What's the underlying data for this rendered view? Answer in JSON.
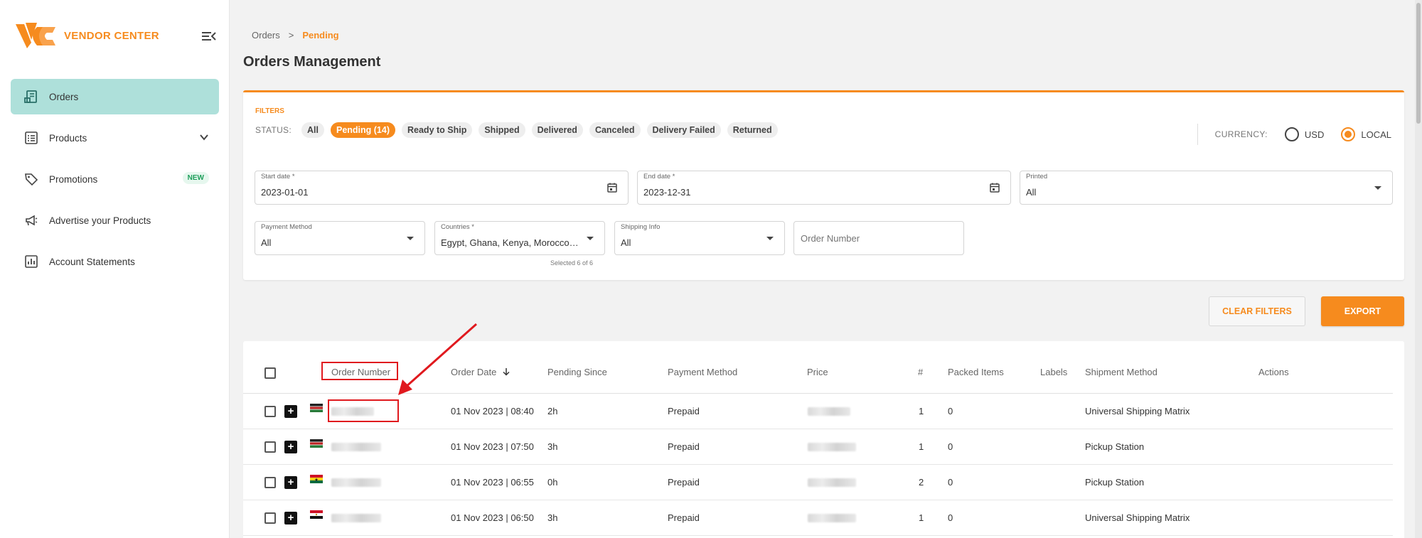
{
  "brand": {
    "name": "VENDOR CENTER",
    "accent": "#f68b1e",
    "active_nav_bg": "#aee0da"
  },
  "sidebar": {
    "collapse_icon": "menu-collapse-icon",
    "items": [
      {
        "label": "Orders",
        "icon": "receipt-icon",
        "active": true
      },
      {
        "label": "Products",
        "icon": "list-icon",
        "has_chevron": true
      },
      {
        "label": "Promotions",
        "icon": "tag-icon",
        "badge": "NEW"
      },
      {
        "label": "Advertise your Products",
        "icon": "megaphone-icon"
      },
      {
        "label": "Account Statements",
        "icon": "chart-icon"
      }
    ]
  },
  "breadcrumb": {
    "parent": "Orders",
    "separator": ">",
    "current": "Pending"
  },
  "page_title": "Orders Management",
  "filters": {
    "label": "FILTERS",
    "status_label": "STATUS:",
    "statuses": [
      "All",
      "Pending (14)",
      "Ready to Ship",
      "Shipped",
      "Delivered",
      "Canceled",
      "Delivery Failed",
      "Returned"
    ],
    "active_status": "Pending (14)",
    "currency": {
      "label": "CURRENCY:",
      "options": [
        "USD",
        "LOCAL"
      ],
      "selected": "LOCAL"
    },
    "start_date": {
      "label": "Start date *",
      "value": "2023-01-01"
    },
    "end_date": {
      "label": "End date *",
      "value": "2023-12-31"
    },
    "printed": {
      "label": "Printed",
      "value": "All"
    },
    "payment_method": {
      "label": "Payment Method",
      "value": "All"
    },
    "countries": {
      "label": "Countries *",
      "value": "Egypt, Ghana, Kenya, Morocco, ...",
      "helper": "Selected 6 of 6"
    },
    "shipping_info": {
      "label": "Shipping Info",
      "value": "All"
    },
    "order_number": {
      "placeholder": "Order Number"
    }
  },
  "actions": {
    "clear": "CLEAR FILTERS",
    "export": "EXPORT"
  },
  "table": {
    "headers": [
      "Order Number",
      "Order Date",
      "Pending Since",
      "Payment Method",
      "Price",
      "#",
      "Packed Items",
      "Labels",
      "Shipment Method",
      "Actions"
    ],
    "rows": [
      {
        "flag": "kenya",
        "order_date": "01 Nov 2023 | 08:40",
        "pending_since": "2h",
        "payment": "Prepaid",
        "qty": "1",
        "packed": "0",
        "shipment": "Universal Shipping Matrix"
      },
      {
        "flag": "kenya",
        "order_date": "01 Nov 2023 | 07:50",
        "pending_since": "3h",
        "payment": "Prepaid",
        "qty": "1",
        "packed": "0",
        "shipment": "Pickup Station"
      },
      {
        "flag": "ghana",
        "order_date": "01 Nov 2023 | 06:55",
        "pending_since": "0h",
        "payment": "Prepaid",
        "qty": "2",
        "packed": "0",
        "shipment": "Pickup Station"
      },
      {
        "flag": "egypt",
        "order_date": "01 Nov 2023 | 06:50",
        "pending_since": "3h",
        "payment": "Prepaid",
        "qty": "1",
        "packed": "0",
        "shipment": "Universal Shipping Matrix"
      }
    ]
  },
  "annotation_color": "#e0191e"
}
